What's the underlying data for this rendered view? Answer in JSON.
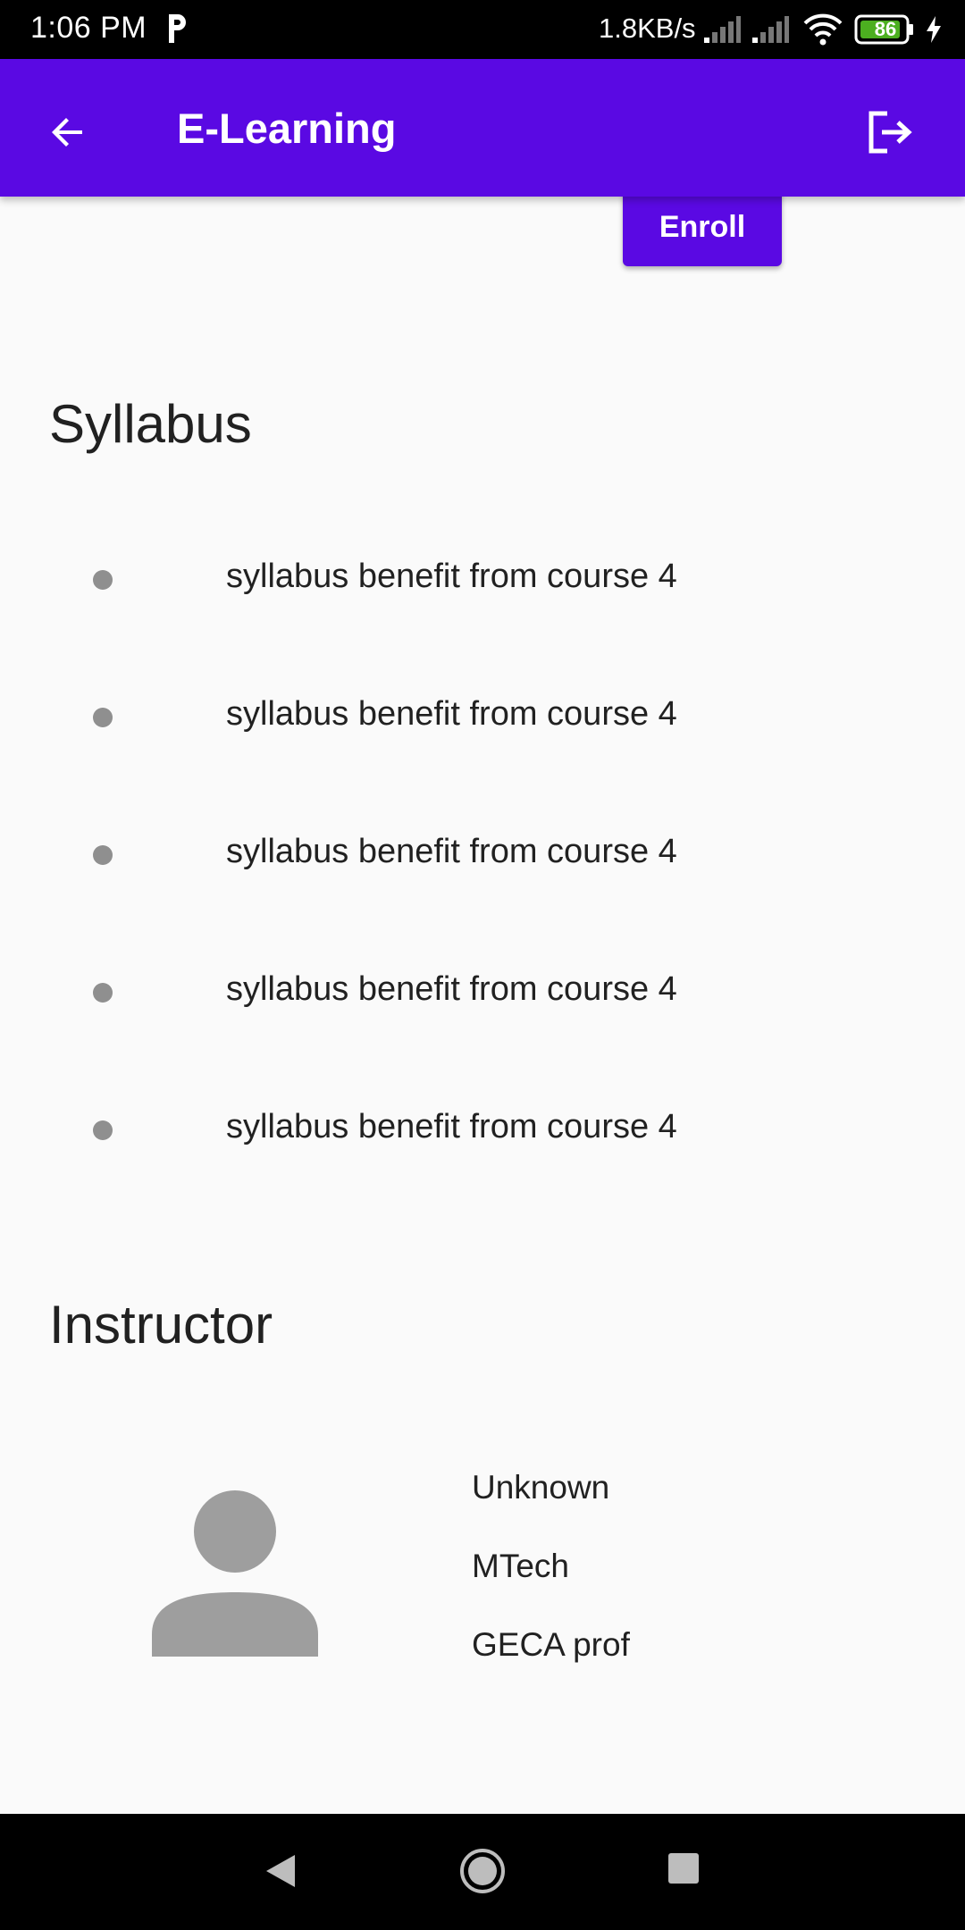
{
  "status_bar": {
    "time": "1:06 PM",
    "network_speed": "1.8KB/s",
    "battery_level": "86",
    "icons": [
      "p-icon",
      "signal-icon",
      "signal-icon",
      "wifi-icon",
      "battery-icon",
      "charging-icon"
    ]
  },
  "app_bar": {
    "title": "E-Learning",
    "color": "#5a09e3",
    "left_icon": "back-arrow-icon",
    "right_icon": "logout-icon"
  },
  "enroll": {
    "label": "Enroll"
  },
  "syllabus": {
    "heading": "Syllabus",
    "items": [
      "syllabus benefit from course 4",
      "syllabus benefit from course 4",
      "syllabus benefit from course 4",
      "syllabus benefit from course 4",
      "syllabus benefit from course 4"
    ]
  },
  "instructor": {
    "heading": "Instructor",
    "avatar_icon": "person-icon",
    "name": "Unknown",
    "qualification": "MTech",
    "position": "GECA prof"
  },
  "nav_bar": {
    "icons": [
      "back-triangle-icon",
      "home-circle-icon",
      "recents-square-icon"
    ]
  }
}
